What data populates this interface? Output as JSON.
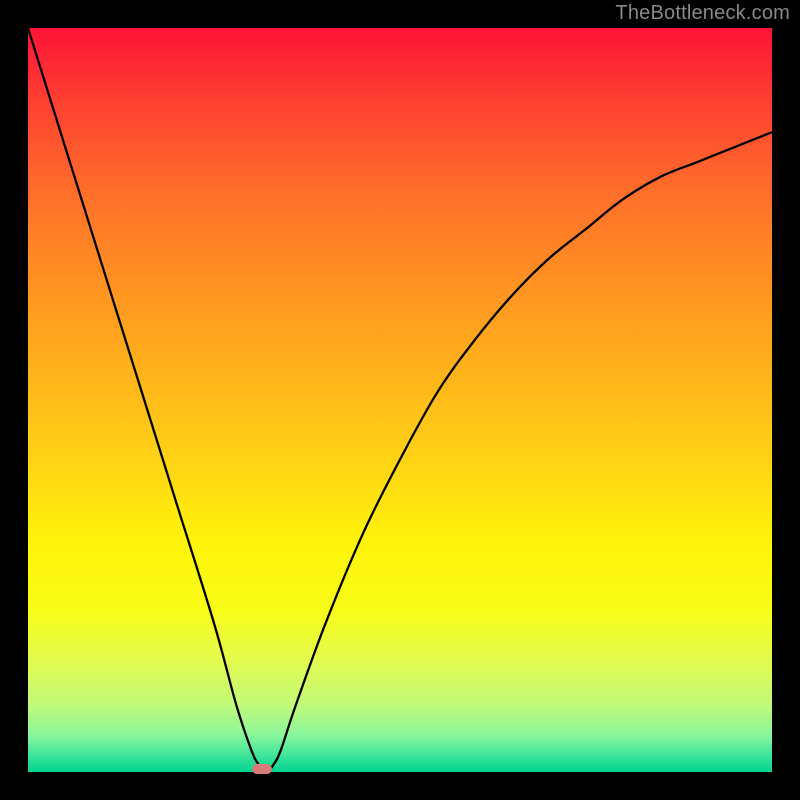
{
  "watermark": "TheBottleneck.com",
  "chart_data": {
    "type": "line",
    "title": "",
    "xlabel": "",
    "ylabel": "",
    "xlim": [
      0,
      100
    ],
    "ylim": [
      0,
      100
    ],
    "x": [
      0,
      5,
      10,
      15,
      20,
      25,
      28,
      30,
      31,
      32,
      33,
      34,
      36,
      40,
      45,
      50,
      55,
      60,
      65,
      70,
      75,
      80,
      85,
      90,
      95,
      100
    ],
    "values": [
      100,
      84,
      68,
      52,
      36,
      20,
      9,
      3,
      1,
      0,
      1,
      3,
      9,
      20,
      32,
      42,
      51,
      58,
      64,
      69,
      73,
      77,
      80,
      82,
      84,
      86
    ],
    "minimum": {
      "x": 31.5,
      "y": 0
    },
    "gradient_description": "red (top) through orange and yellow to green (bottom)",
    "curve_color": "#000000"
  }
}
